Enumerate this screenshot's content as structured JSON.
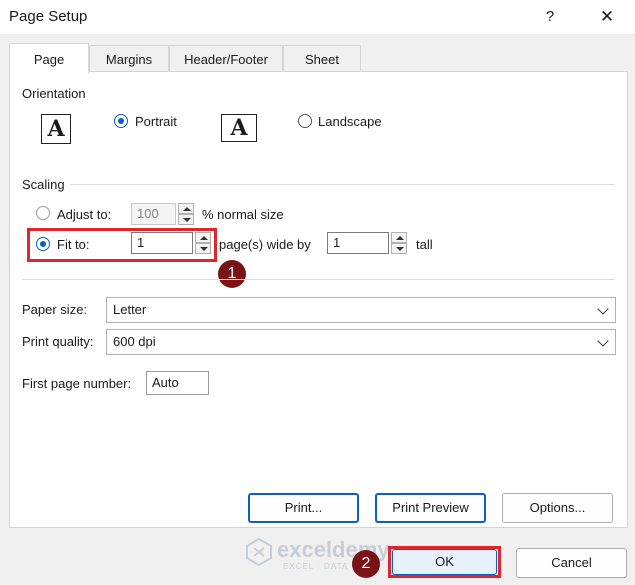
{
  "dialog": {
    "title": "Page Setup",
    "help": "?",
    "close": "✕"
  },
  "tabs": [
    {
      "label": "Page",
      "active": true
    },
    {
      "label": "Margins",
      "active": false
    },
    {
      "label": "Header/Footer",
      "active": false
    },
    {
      "label": "Sheet",
      "active": false
    }
  ],
  "orientation": {
    "section_label": "Orientation",
    "portrait_label": "Portrait",
    "landscape_label": "Landscape",
    "selected": "Portrait",
    "icon_letter": "A"
  },
  "scaling": {
    "section_label": "Scaling",
    "adjust_label": "Adjust to:",
    "adjust_value": "100",
    "adjust_suffix": "% normal size",
    "fit_label": "Fit to:",
    "fit_wide_value": "1",
    "fit_wide_suffix": "page(s) wide by",
    "fit_tall_value": "1",
    "fit_tall_suffix": "tall",
    "selected": "Fit to"
  },
  "paper_size": {
    "label": "Paper size:",
    "value": "Letter"
  },
  "print_quality": {
    "label": "Print quality:",
    "value": "600 dpi"
  },
  "first_page": {
    "label": "First page number:",
    "value": "Auto"
  },
  "buttons": {
    "print": "Print...",
    "print_preview": "Print Preview",
    "options": "Options...",
    "ok": "OK",
    "cancel": "Cancel"
  },
  "annotations": {
    "badge1": "1",
    "badge2": "2",
    "highlight_color": "#e0262b",
    "badge_color": "#7b1316"
  },
  "watermark": {
    "name": "exceldemy",
    "tagline": "EXCEL · DATA · BI"
  },
  "colors": {
    "accent": "#0a5fbf"
  }
}
